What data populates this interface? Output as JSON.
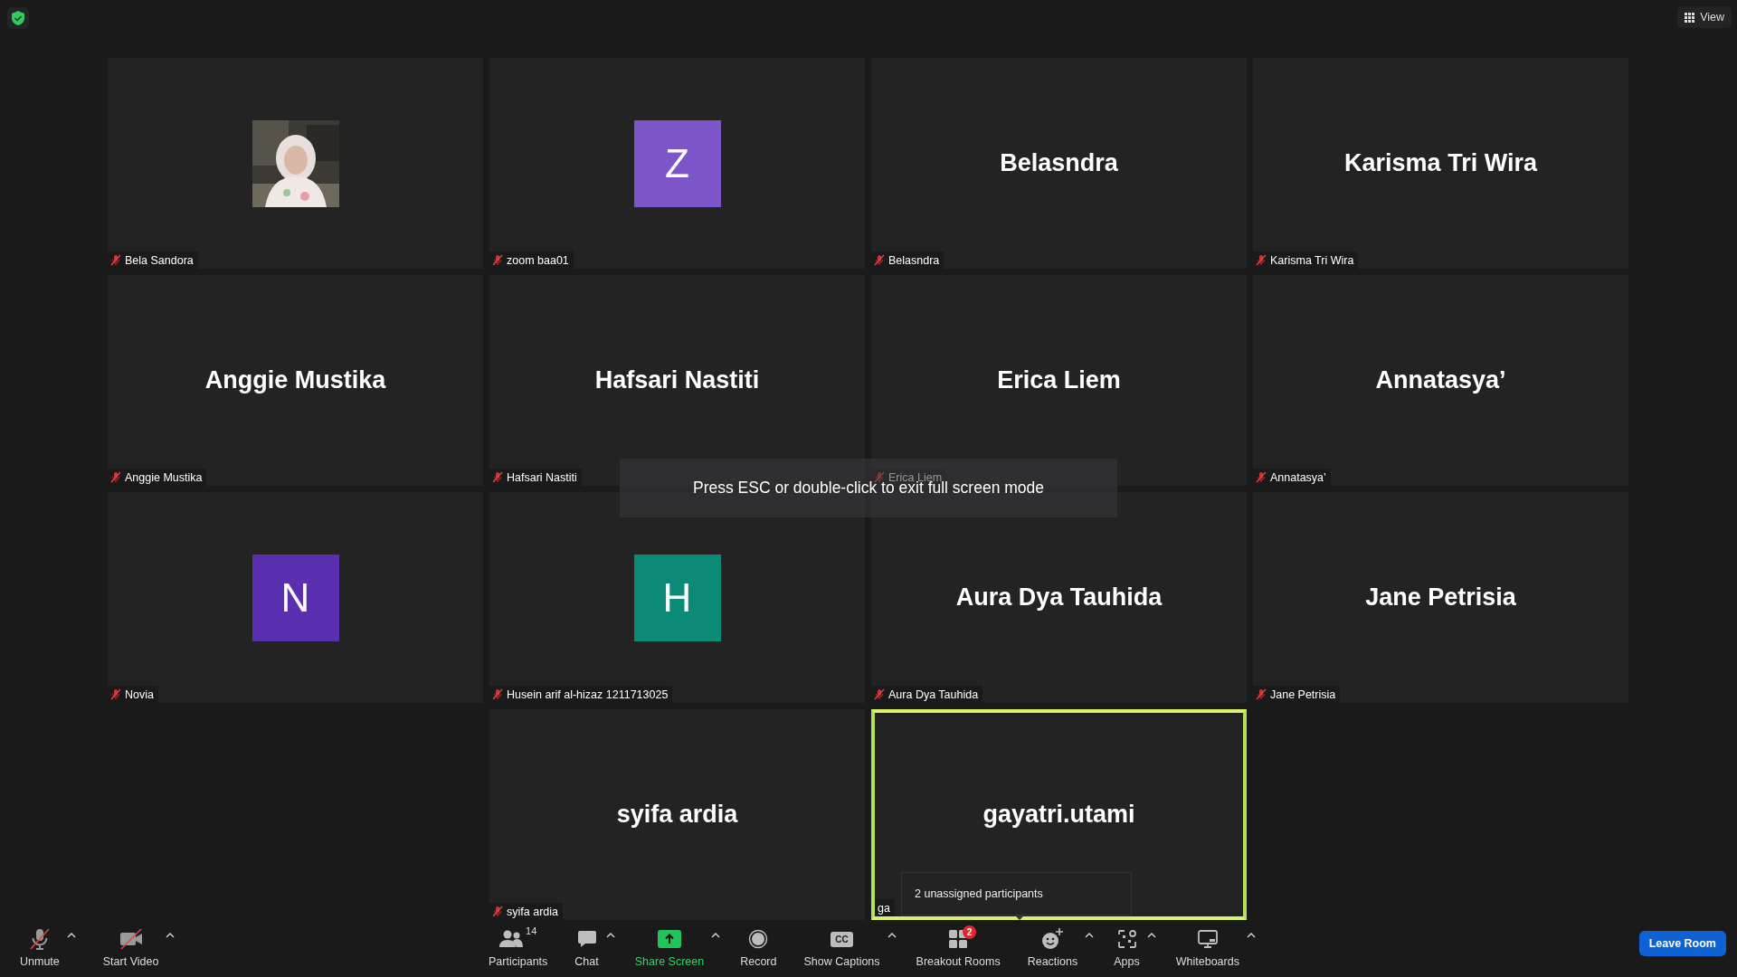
{
  "top_bar": {
    "view_button": "View"
  },
  "tile_rows": [
    [
      {
        "kind": "picture",
        "name": "Bela Sandora",
        "muted": true,
        "active": false
      },
      {
        "kind": "avatar",
        "letter": "Z",
        "color": "#7c55c9",
        "name": "zoom baa01",
        "muted": true,
        "active": false
      },
      {
        "kind": "name",
        "display": "Belasndra",
        "name": "Belasndra",
        "muted": true,
        "active": false
      },
      {
        "kind": "name",
        "display": "Karisma Tri Wira",
        "name": "Karisma Tri Wira",
        "muted": true,
        "active": false
      }
    ],
    [
      {
        "kind": "name",
        "display": "Anggie Mustika",
        "name": "Anggie Mustika",
        "muted": true,
        "active": false
      },
      {
        "kind": "name",
        "display": "Hafsari Nastiti",
        "name": "Hafsari Nastiti",
        "muted": true,
        "active": false
      },
      {
        "kind": "name",
        "display": "Erica Liem",
        "name": "Erica Liem",
        "muted": true,
        "active": false
      },
      {
        "kind": "name",
        "display": "Annatasya’",
        "name": "Annatasya’",
        "muted": true,
        "active": false
      }
    ],
    [
      {
        "kind": "avatar",
        "letter": "N",
        "color": "#5a2fb0",
        "name": "Novia",
        "muted": true,
        "active": false
      },
      {
        "kind": "avatar",
        "letter": "H",
        "color": "#0b8a78",
        "name": "Husein arif al-hizaz 1211713025",
        "muted": true,
        "active": false
      },
      {
        "kind": "name",
        "display": "Aura Dya Tauhida",
        "name": "Aura Dya Tauhida",
        "muted": true,
        "active": false
      },
      {
        "kind": "name",
        "display": "Jane Petrisia",
        "name": "Jane Petrisia",
        "muted": true,
        "active": false
      }
    ],
    [
      {
        "kind": "name",
        "display": "syifa ardia",
        "name": "syifa ardia",
        "muted": true,
        "active": false
      },
      {
        "kind": "name",
        "display": "gayatri.utami",
        "name": "ga",
        "muted": false,
        "active": true
      }
    ]
  ],
  "fullscreen_notice": "Press ESC or double-click to exit full screen mode",
  "breakout_tooltip": "2 unassigned participants",
  "toolbar": {
    "left": [
      {
        "kind": "mic",
        "label": "Unmute",
        "caret": true
      },
      {
        "kind": "video",
        "label": "Start Video",
        "caret": true
      }
    ],
    "center": [
      {
        "kind": "participants",
        "label": "Participants",
        "count": "14",
        "caret": false
      },
      {
        "kind": "chat",
        "label": "Chat",
        "caret": true
      },
      {
        "kind": "share",
        "label": "Share Screen",
        "caret": true
      },
      {
        "kind": "record",
        "label": "Record",
        "caret": false
      },
      {
        "kind": "captions",
        "label": "Show Captions",
        "icon_text": "CC",
        "caret": true
      },
      {
        "kind": "breakout",
        "label": "Breakout Rooms",
        "badge": "2",
        "caret": false
      },
      {
        "kind": "reactions",
        "label": "Reactions",
        "caret": true
      },
      {
        "kind": "apps",
        "label": "Apps",
        "caret": true
      },
      {
        "kind": "whiteboards",
        "label": "Whiteboards",
        "caret": true
      }
    ],
    "leave_button": "Leave Room"
  }
}
